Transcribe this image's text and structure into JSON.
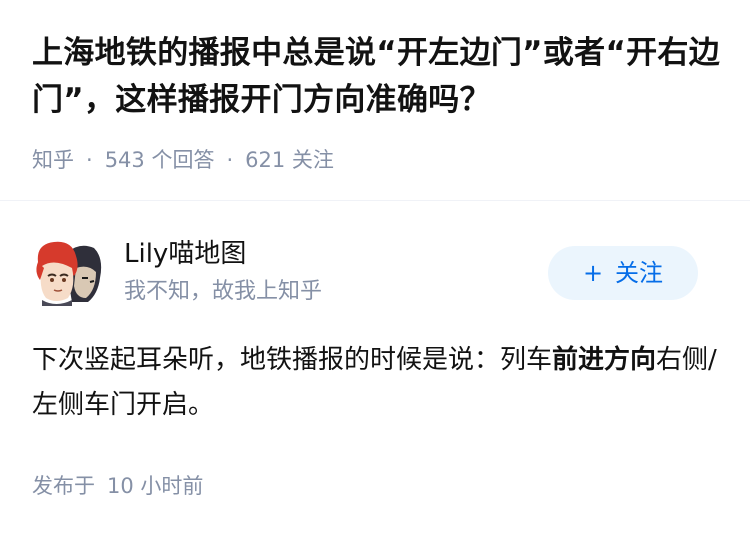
{
  "question": {
    "title": "上海地铁的播报中总是说“开左边门”或者“开右边门”，这样播报开门方向准确吗？",
    "source": "知乎",
    "answer_count": "543 个回答",
    "follower_count": "621 关注"
  },
  "author": {
    "name": "Lily喵地图",
    "bio": "我不知，故我上知乎",
    "follow_label": "关注",
    "follow_icon": "plus-icon"
  },
  "answer": {
    "text_before": "下次竖起耳朵听，地铁播报的时候是说：列车",
    "text_bold": "前进方向",
    "text_after": "右侧/左侧车门开启。",
    "published_label": "发布于",
    "published_time": "10 小时前"
  },
  "colors": {
    "title": "#121212",
    "meta": "#8590a6",
    "follow_bg": "#ebf5fd",
    "follow_text": "#056de8"
  }
}
